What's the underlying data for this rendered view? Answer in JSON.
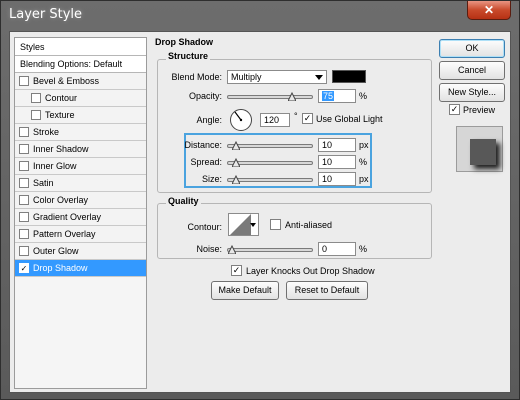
{
  "window": {
    "title": "Layer Style",
    "close_glyph": "✕"
  },
  "sidebar": {
    "header": "Styles",
    "blending_options": "Blending Options: Default",
    "items": [
      {
        "label": "Bevel & Emboss",
        "checked": false
      },
      {
        "label": "Contour",
        "checked": false,
        "indent": true
      },
      {
        "label": "Texture",
        "checked": false,
        "indent": true
      },
      {
        "label": "Stroke",
        "checked": false
      },
      {
        "label": "Inner Shadow",
        "checked": false
      },
      {
        "label": "Inner Glow",
        "checked": false
      },
      {
        "label": "Satin",
        "checked": false
      },
      {
        "label": "Color Overlay",
        "checked": false
      },
      {
        "label": "Gradient Overlay",
        "checked": false
      },
      {
        "label": "Pattern Overlay",
        "checked": false
      },
      {
        "label": "Outer Glow",
        "checked": false
      },
      {
        "label": "Drop Shadow",
        "checked": true,
        "selected": true
      }
    ],
    "check_glyph": "✓"
  },
  "drop_shadow": {
    "title": "Drop Shadow",
    "structure": {
      "title": "Structure",
      "blend_mode_label": "Blend Mode:",
      "blend_mode_value": "Multiply",
      "shadow_color": "#000000",
      "opacity_label": "Opacity:",
      "opacity_value": "75",
      "opacity_unit": "%",
      "angle_label": "Angle:",
      "angle_value": "120",
      "angle_unit": "°",
      "use_global_light_label": "Use Global Light",
      "use_global_light_checked": true,
      "distance_label": "Distance:",
      "distance_value": "10",
      "distance_unit": "px",
      "spread_label": "Spread:",
      "spread_value": "10",
      "spread_unit": "%",
      "size_label": "Size:",
      "size_value": "10",
      "size_unit": "px"
    },
    "quality": {
      "title": "Quality",
      "contour_label": "Contour:",
      "anti_aliased_label": "Anti-aliased",
      "anti_aliased_checked": false,
      "noise_label": "Noise:",
      "noise_value": "0",
      "noise_unit": "%"
    },
    "layer_knocks_out_label": "Layer Knocks Out Drop Shadow",
    "layer_knocks_out_checked": true,
    "make_default_label": "Make Default",
    "reset_default_label": "Reset to Default"
  },
  "actions": {
    "ok_label": "OK",
    "cancel_label": "Cancel",
    "new_style_label": "New Style...",
    "preview_label": "Preview",
    "preview_checked": true
  },
  "colors": {
    "selection": "#3399ff",
    "highlight_box": "#4aa3df",
    "close_button": "#c94a2b"
  }
}
